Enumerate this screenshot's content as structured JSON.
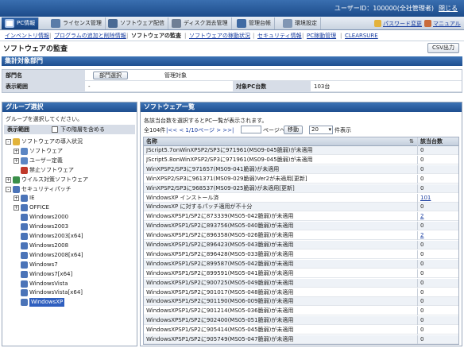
{
  "header": {
    "user": "ユーザーID：100000(全社管理者)",
    "logout": "閉じる"
  },
  "tabs": [
    {
      "label": "PC情報",
      "icon": "pc-icon",
      "active": true
    },
    {
      "label": "ライセンス管理",
      "icon": "license-icon",
      "active": false
    },
    {
      "label": "ソフトウェア配信",
      "icon": "software-delivery-icon",
      "active": false
    },
    {
      "label": "ディスク消去管理",
      "icon": "disk-erase-icon",
      "active": false
    },
    {
      "label": "管理台帳",
      "icon": "ledger-icon",
      "active": false
    },
    {
      "label": "環境設定",
      "icon": "settings-icon",
      "active": false
    }
  ],
  "right_links": {
    "password": "パスワード変更",
    "manual": "マニュアル"
  },
  "subnav": [
    {
      "label": "インベントリ情報",
      "current": false
    },
    {
      "label": "プログラムの追加と削除情報",
      "current": false
    },
    {
      "label": "ソフトウェアの監査",
      "current": true
    },
    {
      "label": "ソフトウェアの稼動状況",
      "current": false
    },
    {
      "label": "セキュリティ情報",
      "current": false
    },
    {
      "label": "PC稼動管理",
      "current": false
    },
    {
      "label": "CLEARSURE",
      "current": false
    }
  ],
  "page": {
    "title": "ソフトウェアの監査",
    "csv": "CSV出力"
  },
  "summary": {
    "section_title": "集計対象部門",
    "dept_label": "部門名",
    "dept_button": "部門選択",
    "dept_value": "管理対象",
    "range_label": "表示範囲",
    "range_value": "-",
    "pc_count_label": "対象PC台数",
    "pc_count_value": "103台"
  },
  "group": {
    "section_title": "グループ選択",
    "instruction": "グループを選択してください。",
    "range_label": "表示範囲",
    "checkbox_label": "下の階層を含める",
    "tree": [
      {
        "label": "ソフトウェアの導入状況",
        "level": 0,
        "exp": "-",
        "icon": "folder-icon"
      },
      {
        "label": "ソフトウェア",
        "level": 1,
        "exp": "+",
        "icon": "software-icon"
      },
      {
        "label": "ユーザー定義",
        "level": 1,
        "exp": "+",
        "icon": "software-icon"
      },
      {
        "label": "禁止ソフトウェア",
        "level": 1,
        "exp": "",
        "icon": "forbidden-icon"
      },
      {
        "label": "ウイルス対策ソフトウェア",
        "level": 0,
        "exp": "+",
        "icon": "antivirus-icon"
      },
      {
        "label": "セキュリティパッチ",
        "level": 0,
        "exp": "-",
        "icon": "patch-icon"
      },
      {
        "label": "IE",
        "level": 1,
        "exp": "+",
        "icon": "patch-icon"
      },
      {
        "label": "OFFICE",
        "level": 1,
        "exp": "+",
        "icon": "patch-icon"
      },
      {
        "label": "Windows2000",
        "level": 1,
        "exp": "",
        "icon": "patch-icon"
      },
      {
        "label": "Windows2003",
        "level": 1,
        "exp": "",
        "icon": "patch-icon"
      },
      {
        "label": "Windows2003[x64]",
        "level": 1,
        "exp": "",
        "icon": "patch-icon"
      },
      {
        "label": "Windows2008",
        "level": 1,
        "exp": "",
        "icon": "patch-icon"
      },
      {
        "label": "Windows2008[x64]",
        "level": 1,
        "exp": "",
        "icon": "patch-icon"
      },
      {
        "label": "Windows7",
        "level": 1,
        "exp": "",
        "icon": "patch-icon"
      },
      {
        "label": "Windows7[x64]",
        "level": 1,
        "exp": "",
        "icon": "patch-icon"
      },
      {
        "label": "WindowsVista",
        "level": 1,
        "exp": "",
        "icon": "patch-icon"
      },
      {
        "label": "WindowsVista[x64]",
        "level": 1,
        "exp": "",
        "icon": "patch-icon"
      },
      {
        "label": "WindowsXP",
        "level": 1,
        "exp": "",
        "icon": "patch-icon",
        "selected": true
      }
    ]
  },
  "software": {
    "section_title": "ソフトウェア一覧",
    "instruction": "各該当台数を選択するとPC一覧が表示されます。",
    "pager": {
      "total": "全104件",
      "prev": "|<< < 1/10ページ > >>|",
      "page_suffix": "ページへ",
      "go": "移動",
      "per_page": "20",
      "per_page_suffix": "件表示"
    },
    "columns": {
      "name": "名称",
      "count": "該当台数"
    },
    "rows": [
      {
        "name": "JScript5.7onWinXPSP2/SP3に971961(MS09-045脆弱)が未適用",
        "count": "0",
        "link": false
      },
      {
        "name": "JScript5.8onWinXPSP2/SP3に971961(MS09-045脆弱)が未適用",
        "count": "0",
        "link": false
      },
      {
        "name": "WinXPSP2/SP3に971657(MS09-041脆弱)が未適用",
        "count": "0",
        "link": false
      },
      {
        "name": "WinXPSP2/SP3に961371(MS09-029脆弱)Ver2が未適用[更新]",
        "count": "0",
        "link": false
      },
      {
        "name": "WinXPSP2/SP3に968537(MS09-025脆弱)が未適用[更新]",
        "count": "0",
        "link": false
      },
      {
        "name": "WindowsXP インストール済",
        "count": "101",
        "link": true
      },
      {
        "name": "WindowsXP に対するパッチ適用が不十分",
        "count": "0",
        "link": false
      },
      {
        "name": "WindowsXPSP1/SP2に873339(MS05-042脆弱)が未適用",
        "count": "2",
        "link": true
      },
      {
        "name": "WindowsXPSP1/SP2に893756(MS05-040脆弱)が未適用",
        "count": "0",
        "link": false
      },
      {
        "name": "WindowsXPSP1/SP2に896358(MS05-026脆弱)が未適用",
        "count": "2",
        "link": true
      },
      {
        "name": "WindowsXPSP1/SP2に896423(MS05-043脆弱)が未適用",
        "count": "0",
        "link": false
      },
      {
        "name": "WindowsXPSP1/SP2に896428(MS05-033脆弱)が未適用",
        "count": "0",
        "link": false
      },
      {
        "name": "WindowsXPSP1/SP2に899587(MS05-042脆弱)が未適用",
        "count": "0",
        "link": false
      },
      {
        "name": "WindowsXPSP1/SP2に899591(MS05-041脆弱)が未適用",
        "count": "0",
        "link": false
      },
      {
        "name": "WindowsXPSP1/SP2に900725(MS05-049脆弱)が未適用",
        "count": "0",
        "link": false
      },
      {
        "name": "WindowsXPSP1/SP2に901017(MS05-048脆弱)が未適用",
        "count": "0",
        "link": false
      },
      {
        "name": "WindowsXPSP1/SP2に901190(MS06-009脆弱)が未適用",
        "count": "0",
        "link": false
      },
      {
        "name": "WindowsXPSP1/SP2に901214(MS05-036脆弱)が未適用",
        "count": "0",
        "link": false
      },
      {
        "name": "WindowsXPSP1/SP2に902400(MS05-051脆弱)が未適用",
        "count": "0",
        "link": false
      },
      {
        "name": "WindowsXPSP1/SP2に905414(MS05-045脆弱)が未適用",
        "count": "0",
        "link": false
      },
      {
        "name": "WindowsXPSP1/SP2に905749(MS05-047脆弱)が未適用",
        "count": "0",
        "link": false
      }
    ]
  },
  "colors": {
    "header_blue": "#1c4b8a",
    "link": "#1a3ea0",
    "label_bg": "#d7dde7"
  }
}
